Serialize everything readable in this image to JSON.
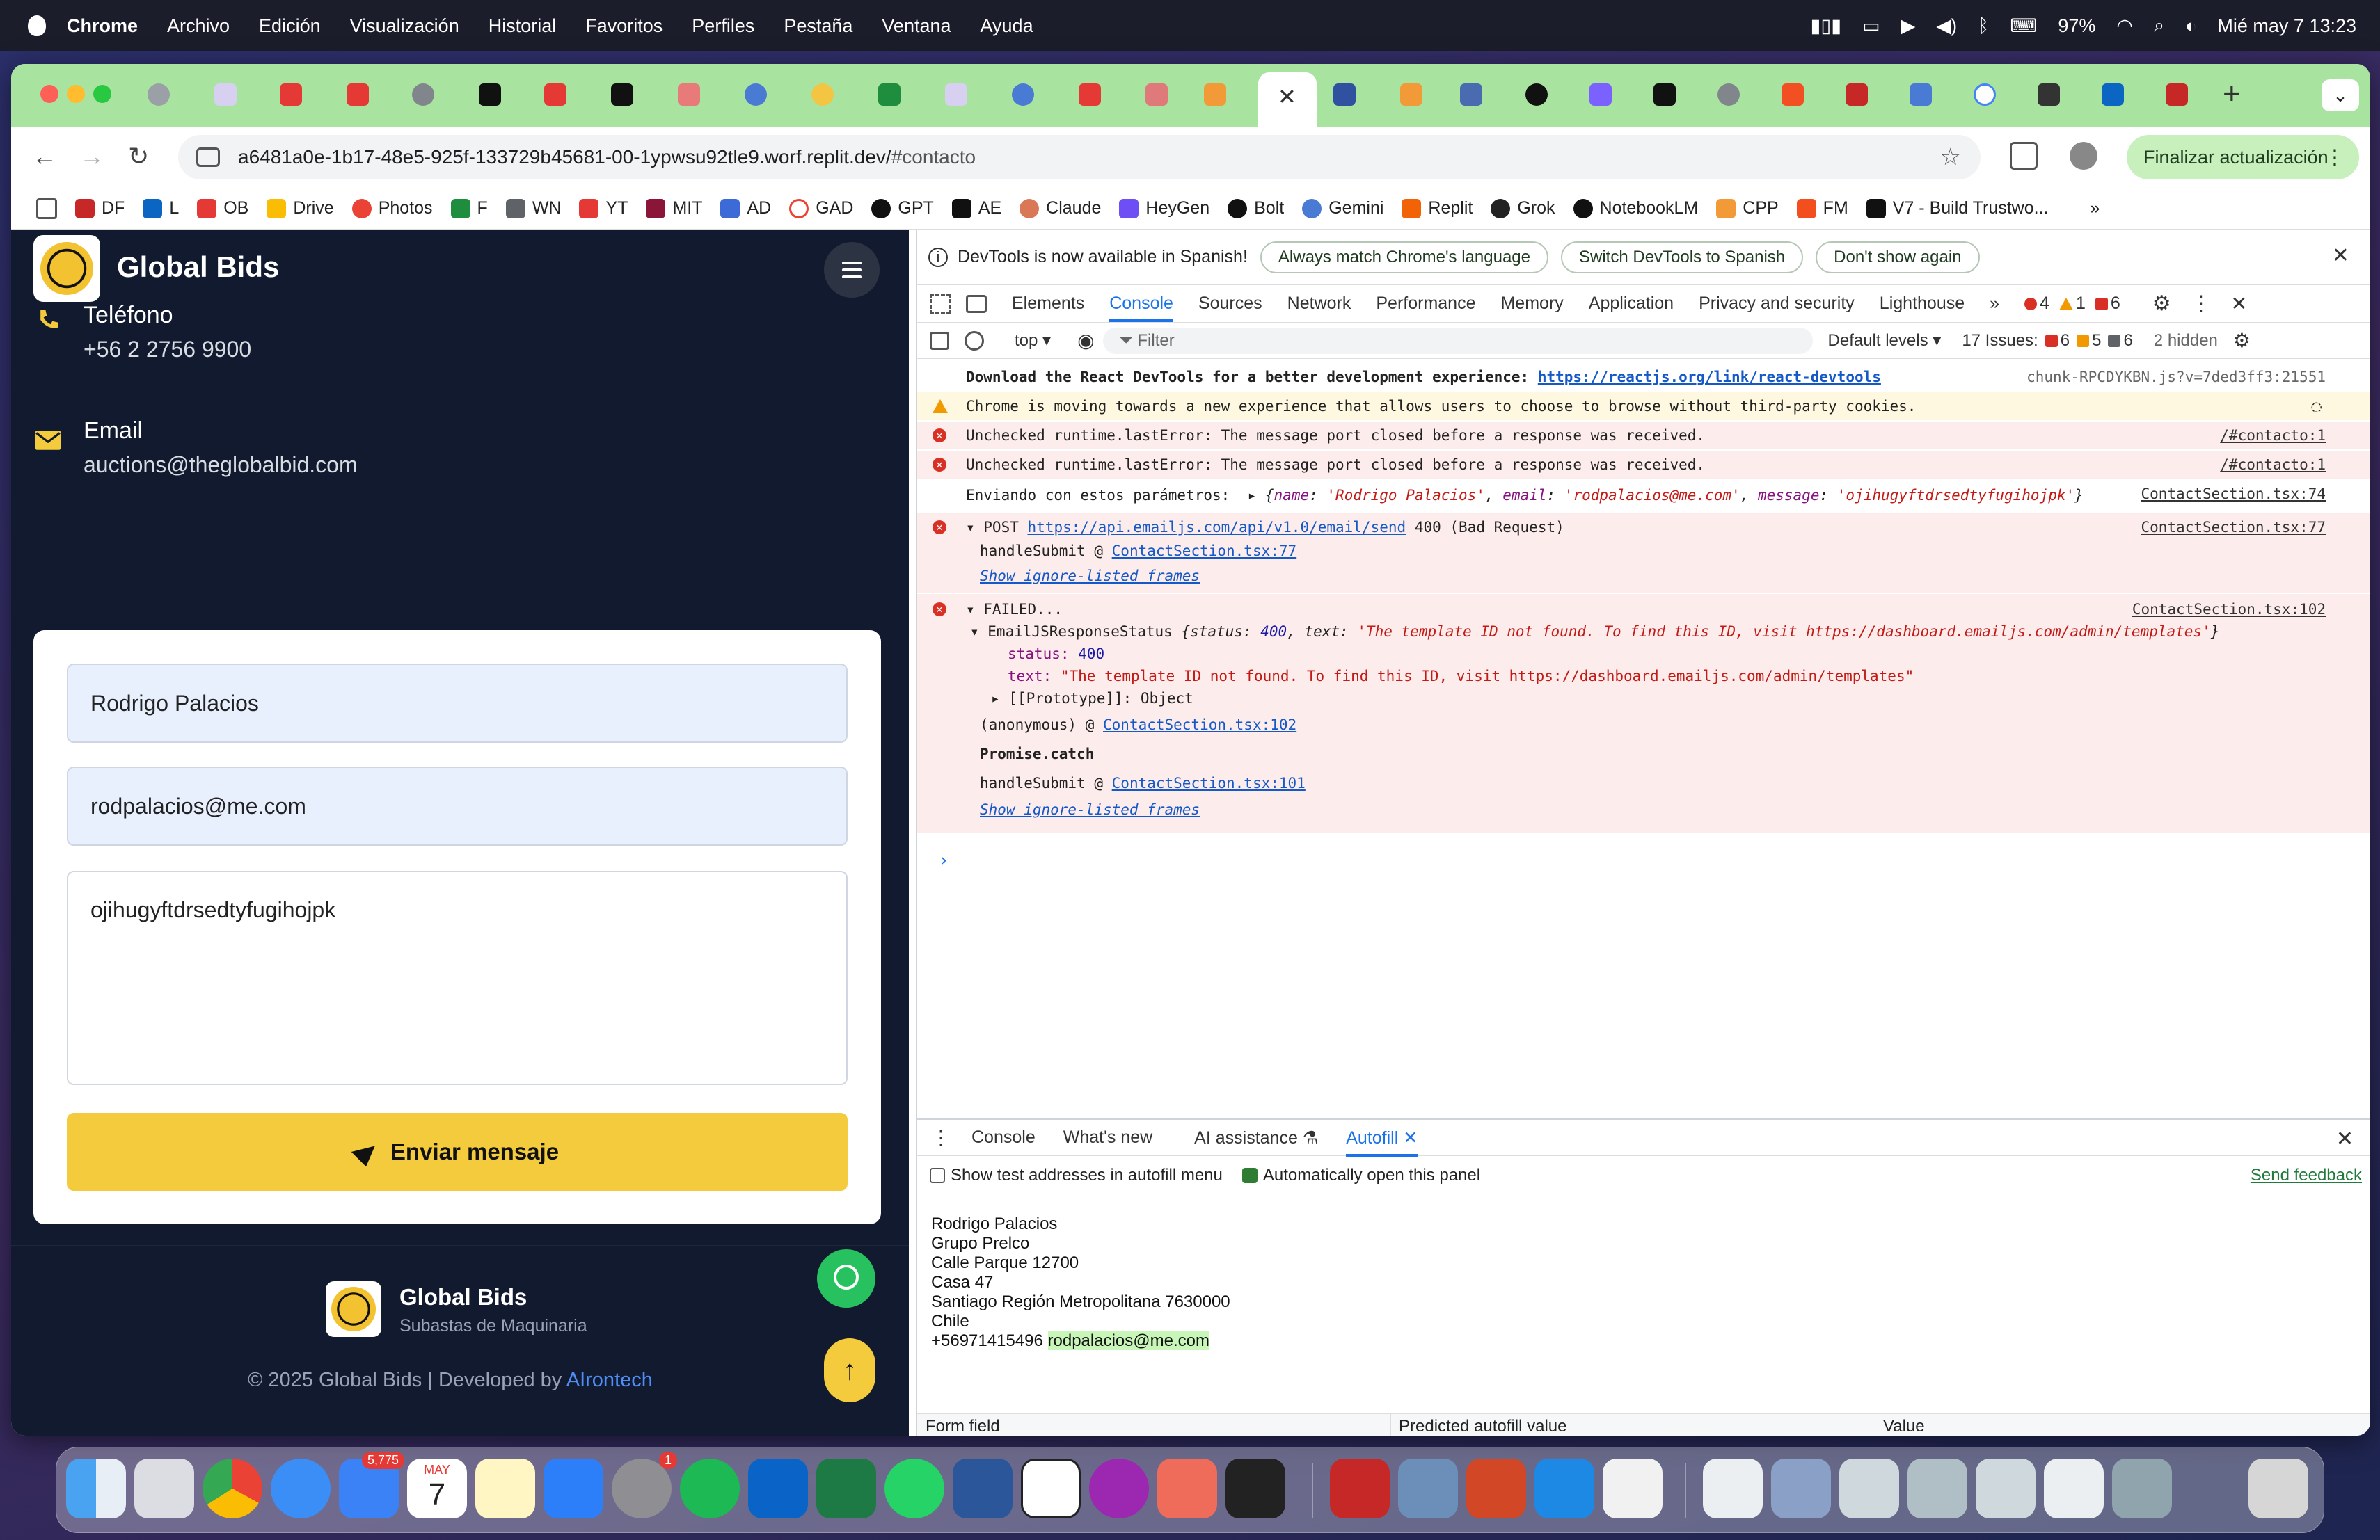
{
  "menubar": {
    "app": "Chrome",
    "items": [
      "Archivo",
      "Edición",
      "Visualización",
      "Historial",
      "Favoritos",
      "Perfiles",
      "Pestaña",
      "Ventana",
      "Ayuda"
    ],
    "battery": "97%",
    "datetime": "Mié may 7  13:23"
  },
  "browser": {
    "url_main": "a6481a0e-1b17-48e5-925f-133729b45681-00-1ypwsu92tle9.worf.replit.dev/",
    "url_hash": "#contacto",
    "update_label": "Finalizar actualización",
    "bookmarks": [
      "DF",
      "L",
      "OB",
      "Drive",
      "Photos",
      "F",
      "WN",
      "YT",
      "MIT",
      "AD",
      "GAD",
      "GPT",
      "AE",
      "Claude",
      "HeyGen",
      "Bolt",
      "Gemini",
      "Replit",
      "Grok",
      "NotebookLM",
      "CPP",
      "FM",
      "V7 - Build Trustwo..."
    ],
    "more_bookmarks": "»"
  },
  "site": {
    "brand": "Global Bids",
    "phone_label": "Teléfono",
    "phone_value": "+56 2 2756 9900",
    "email_label": "Email",
    "email_value": "auctions@theglobalbid.com",
    "form": {
      "name_value": "Rodrigo Palacios",
      "email_value": "rodpalacios@me.com",
      "message_value": "ojihugyftdrsedtyfugihojpk",
      "submit_label": "Enviar mensaje"
    },
    "footer": {
      "brand": "Global Bids",
      "tagline": "Subastas de Maquinaria",
      "copyright": "© 2025 Global Bids  |  Developed by ",
      "developer": "AIrontech"
    }
  },
  "devtools": {
    "info_bar": {
      "text": "DevTools is now available in Spanish!",
      "btn_match": "Always match Chrome's language",
      "btn_switch": "Switch DevTools to Spanish",
      "btn_dismiss": "Don't show again"
    },
    "tabs": [
      "Elements",
      "Console",
      "Sources",
      "Network",
      "Performance",
      "Memory",
      "Application",
      "Privacy and security",
      "Lighthouse"
    ],
    "active_tab": "Console",
    "counts": {
      "errors": "4",
      "warnings": "1",
      "issues": "6"
    },
    "console_bar": {
      "context": "top ▾",
      "filter_placeholder": "Filter",
      "levels": "Default levels ▾",
      "issues_label": "17 Issues:",
      "issue_err": "6",
      "issue_warn": "5",
      "issue_info": "6",
      "hidden": "2 hidden"
    },
    "log": {
      "r1_text": "Download the React DevTools for a better development experience: ",
      "r1_link": "https://reactjs.org/link/react-devtools",
      "r1_src": "chunk-RPCDYKBN.js?v=7ded3ff3:21551",
      "r2_text": "Chrome is moving towards a new experience that allows users to choose to browse without third-party cookies.",
      "r3_text": "Unchecked runtime.lastError: The message port closed before a response was received.",
      "r3_src": "/#contacto:1",
      "r4_text": "Unchecked runtime.lastError: The message port closed before a response was received.",
      "r4_src": "/#contacto:1",
      "r5_text": "Enviando con estos parámetros:",
      "r5_obj_open": "▸ {",
      "r5_k1": "name",
      "r5_v1": "'Rodrigo Palacios'",
      "r5_k2": "email",
      "r5_v2": "'rodpalacios@me.com'",
      "r5_k3": "message",
      "r5_v3": "'ojihugyftdrsedtyfugihojpk'",
      "r5_close": "}",
      "r5_src": "ContactSection.tsx:74",
      "r6_method": "▾ POST ",
      "r6_url": "https://api.emailjs.com/api/v1.0/email/send",
      "r6_status": " 400 (Bad Request)",
      "r6_src": "ContactSection.tsx:77",
      "r6_stack1": "handleSubmit @ ",
      "r6_stack1_src": "ContactSection.tsx:77",
      "r6_show": "Show ignore-listed frames",
      "r7_head": "▾ FAILED...",
      "r7_src": "ContactSection.tsx:102",
      "r7_obj_name": "▾ EmailJSResponseStatus ",
      "r7_obj_preview_a": "{status: ",
      "r7_obj_status_val": "400",
      "r7_obj_preview_b": ", text: ",
      "r7_obj_text_val": "'The template ID not found. To find this ID, visit https://dashboard.emailjs.com/admin/templates'",
      "r7_obj_preview_c": "}",
      "r7_status_key": "status: ",
      "r7_status_val": "400",
      "r7_text_key": "text: ",
      "r7_text_val": "\"The template ID not found. To find this ID, visit https://dashboard.emailjs.com/admin/templates\"",
      "r7_proto": "▸ [[Prototype]]: Object",
      "r7_anon": "(anonymous)   @ ",
      "r7_anon_src": "ContactSection.tsx:102",
      "r7_promise": "Promise.catch",
      "r7_handle": "handleSubmit  @ ",
      "r7_handle_src": "ContactSection.tsx:101",
      "r7_show": "Show ignore-listed frames",
      "prompt": "›"
    },
    "drawer": {
      "tabs": [
        "Console",
        "What's new",
        "AI assistance",
        "Autofill"
      ],
      "active": "Autofill",
      "opt1": "Show test addresses in autofill menu",
      "opt2": "Automatically open this panel",
      "feedback": "Send feedback",
      "address_lines": [
        "Rodrigo Palacios",
        "Grupo Prelco",
        "Calle Parque 12700",
        "Casa 47",
        "Santiago Región Metropolitana 7630000",
        "Chile"
      ],
      "phone": "+56971415496 ",
      "email": "rodpalacios@me.com",
      "col1": "Form field",
      "col2": "Predicted autofill value",
      "col3": "Value"
    }
  },
  "dock": {
    "mail_badge": "5,775",
    "calendar_month": "MAY",
    "calendar_day": "7",
    "settings_badge": "1"
  }
}
